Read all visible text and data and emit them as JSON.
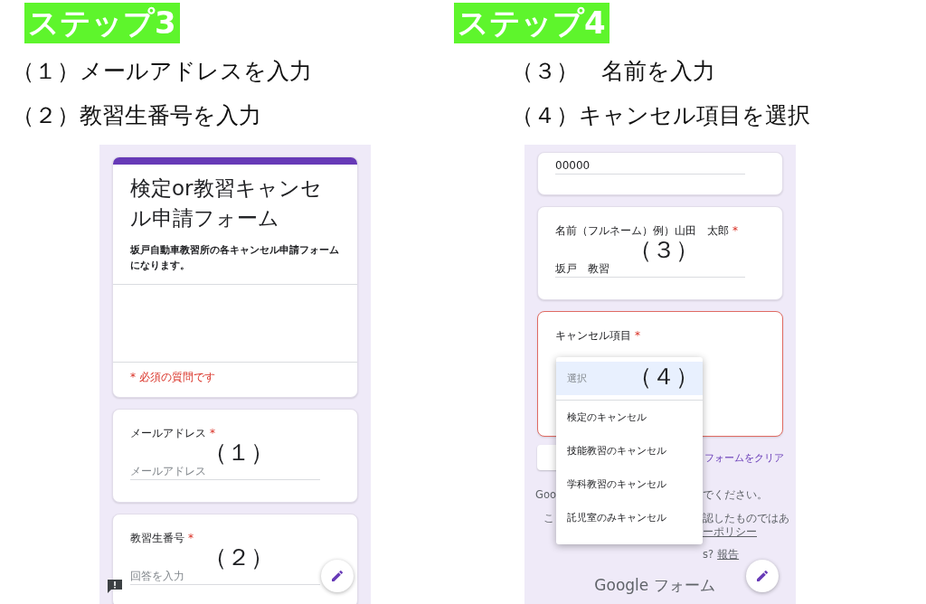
{
  "steps": [
    {
      "badge": "ステップ3",
      "instructions": [
        "（１）メールアドレスを入力",
        "（２）教習生番号を入力"
      ],
      "screen": {
        "header": {
          "title": "検定or教習キャンセル申請フォーム",
          "description": "坂戸自動車教習所の各キャンセル申請フォームになります。",
          "required_note": "* 必須の質問です"
        },
        "questions": [
          {
            "label": "メールアドレス",
            "required_mark": "*",
            "placeholder": "メールアドレス",
            "callout": "（１）",
            "error": false
          },
          {
            "label": "教習生番号",
            "required_mark": "*",
            "placeholder": "回答を入力",
            "callout": "（２）",
            "error": false
          }
        ],
        "feedback_button": true
      }
    },
    {
      "badge": "ステップ4",
      "instructions": [
        "（３）　名前を入力",
        "（４）キャンセル項目を選択"
      ],
      "screen": {
        "questions": [
          {
            "value": "00000",
            "error": false
          },
          {
            "label": "名前（フルネーム）例）山田　太郎",
            "required_mark": "*",
            "value": "坂戸　教習",
            "callout": "（３）",
            "error": false
          },
          {
            "label": "キャンセル項目",
            "required_mark": "*",
            "error": true,
            "dropdown": {
              "callout": "（４）",
              "options": [
                {
                  "label": "選択",
                  "selected": true
                },
                {
                  "label": "検定のキャンセル",
                  "selected": false
                },
                {
                  "label": "技能教習のキャンセル",
                  "selected": false
                },
                {
                  "label": "学科教習のキャンセル",
                  "selected": false
                },
                {
                  "label": "託児室のみキャンセル",
                  "selected": false
                }
              ]
            }
          }
        ],
        "clear_link": "フォームをクリア",
        "footer_rows": [
          {
            "left": "Goo",
            "right": [
              {
                "text": "でください。",
                "link": false
              }
            ]
          },
          {
            "left": "こ",
            "right": [
              {
                "text": "認したものではあ",
                "link": false
              }
            ]
          },
          {
            "right": [
              {
                "text": "ーポリシー",
                "link": true
              }
            ]
          },
          {
            "right": [
              {
                "text": "s?",
                "link": false
              },
              {
                "text": "報告",
                "link": true
              }
            ]
          }
        ],
        "brand": "Google フォーム"
      }
    }
  ]
}
